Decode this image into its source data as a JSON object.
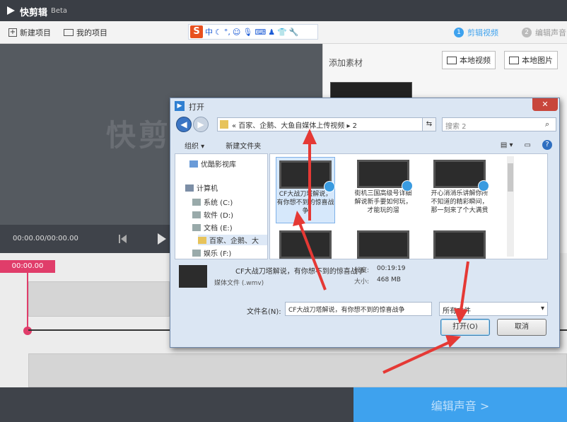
{
  "app": {
    "title": "快剪辑",
    "edition": "Beta"
  },
  "toolbar": {
    "new_project": "新建项目",
    "my_projects": "我的项目",
    "ime": {
      "logo": "S",
      "mode": "中",
      "icons": [
        "moon-icon",
        "punctuation-icon",
        "smile-icon",
        "microphone-icon",
        "keyboard-icon",
        "user-icon",
        "shirt-icon",
        "wrench-icon"
      ]
    },
    "steps": [
      {
        "num": "1",
        "label": "剪辑视频",
        "active": true
      },
      {
        "num": "2",
        "label": "编辑声音",
        "active": false
      }
    ]
  },
  "preview": {
    "watermark": "快剪辑",
    "time": "00:00.00/00:00.00"
  },
  "materials": {
    "label": "添加素材",
    "local_video": "本地视频",
    "local_image": "本地图片"
  },
  "timeline": {
    "badge": "00:00.00"
  },
  "footer": {
    "edit_audio": "编辑声音 >"
  },
  "dialog": {
    "title": "打开",
    "path": "«  百家、企鹅、大鱼自媒体上传视频  ▸  2",
    "search_placeholder": "搜索 2",
    "organize": "组织 ▾",
    "new_folder": "新建文件夹",
    "nav": [
      {
        "label": "优酷影视库",
        "icon": "video-library-icon"
      },
      {
        "label": "计算机",
        "icon": "computer-icon"
      },
      {
        "label": "系统 (C:)",
        "icon": "drive-icon"
      },
      {
        "label": "软件 (D:)",
        "icon": "drive-icon"
      },
      {
        "label": "文档 (E:)",
        "icon": "drive-icon"
      },
      {
        "label": "百家、企鹅、大",
        "icon": "folder-icon"
      },
      {
        "label": "娱乐 (F:)",
        "icon": "drive-icon"
      }
    ],
    "files": [
      {
        "name": "CF大战刀塔解说，有你想不到的惊喜战争",
        "selected": true
      },
      {
        "name": "街机三国高级号详细解说新手要如何玩，才能玩的溜",
        "selected": false
      },
      {
        "name": "开心消消乐讲解你所不知道的精彩瞬间，那一刻来了个大满贯",
        "selected": false
      },
      {
        "name": "",
        "selected": false
      },
      {
        "name": "",
        "selected": false
      },
      {
        "name": "",
        "selected": false
      }
    ],
    "detail": {
      "name": "CF大战刀塔解说，有你想不到的惊喜战争",
      "type": "媒体文件 (.wmv)",
      "duration_label": "长度:",
      "duration": "00:19:19",
      "size_label": "大小:",
      "size": "468 MB"
    },
    "filename_label": "文件名(N):",
    "filename": "CF大战刀塔解说，有你想不到的惊喜战争",
    "filetype": "所有文件",
    "open": "打开(O)",
    "cancel": "取消"
  },
  "colors": {
    "accent": "#3ea2ee",
    "time_badge": "#e03d6a",
    "arrow": "#e53935"
  }
}
